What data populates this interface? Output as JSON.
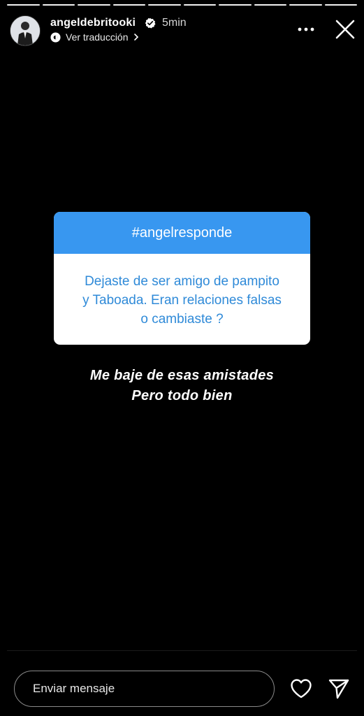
{
  "story": {
    "progress_segments": 10,
    "progress_completed": 10
  },
  "header": {
    "username": "angeldebritooki",
    "verified": true,
    "time": "5min",
    "translate_label": "Ver traducción",
    "icons": {
      "avatar": "profile-photo",
      "verified": "verified-badge-icon",
      "translate": "translate-icon",
      "more": "more-options-icon",
      "close": "close-icon"
    }
  },
  "question_box": {
    "header": "#angelresponde",
    "question": "Dejaste de ser amigo de pampito y Taboada. Eran relaciones falsas o cambiaste ?",
    "question_lines": [
      "Dejaste de ser amigo de pampito",
      "y Taboada. Eran relaciones falsas",
      "o cambiaste ?"
    ],
    "header_color": "#3897f0",
    "text_color": "#2f8ad8"
  },
  "answer": {
    "lines": [
      "Me baje de esas amistades",
      "Pero todo bien"
    ]
  },
  "footer": {
    "message_placeholder": "Enviar mensaje",
    "icons": {
      "like": "heart-icon",
      "send": "send-icon"
    }
  }
}
